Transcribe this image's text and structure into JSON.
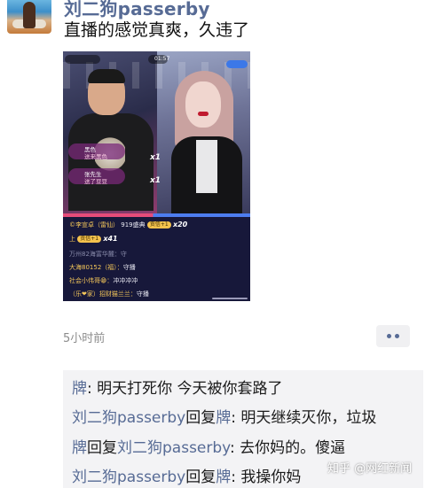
{
  "post": {
    "author": "刘二狗passerby",
    "text": "直播的感觉真爽，久违了",
    "timestamp": "5小时前"
  },
  "livestream": {
    "time": "01:57",
    "x_counts": [
      "x1",
      "x1",
      "x20",
      "x41"
    ],
    "gift_names": [
      "黑色",
      "张先生"
    ],
    "gift_subs": [
      "送来黑色",
      "送了豆豆"
    ],
    "chat": [
      {
        "name": "©李宣卓（雷仙）",
        "text": "919盛典",
        "badge": "贡信+1"
      },
      {
        "name": "上",
        "text": "",
        "badge": "贡信+1"
      },
      {
        "name": "万州82海富华麓：",
        "text": "守"
      },
      {
        "name": "大海80152（福）：",
        "text": "守播"
      },
      {
        "name": "社会小伟哥😁：",
        "text": "冲冲冲冲"
      },
      {
        "name": "（乐❤家）招财猫兰兰：",
        "text": "守播"
      }
    ]
  },
  "comments": [
    {
      "from": "牌",
      "reply_to": "",
      "text": "明天打死你 今天被你套路了"
    },
    {
      "from": "刘二狗passerby",
      "reply_to": "牌",
      "text": "明天继续灭你，垃圾"
    },
    {
      "from": "牌",
      "reply_to": "刘二狗passerby",
      "text": "去你妈的。傻逼"
    },
    {
      "from": "刘二狗passerby",
      "reply_to": "牌",
      "text": "我操你妈"
    }
  ],
  "labels": {
    "reply_word": "回复",
    "separator": ": "
  },
  "watermark": "知乎 @网红新闻",
  "colors": {
    "name_blue": "#576b95",
    "comment_bg": "#f3f3f5",
    "time_gray": "#8c8c8c"
  }
}
